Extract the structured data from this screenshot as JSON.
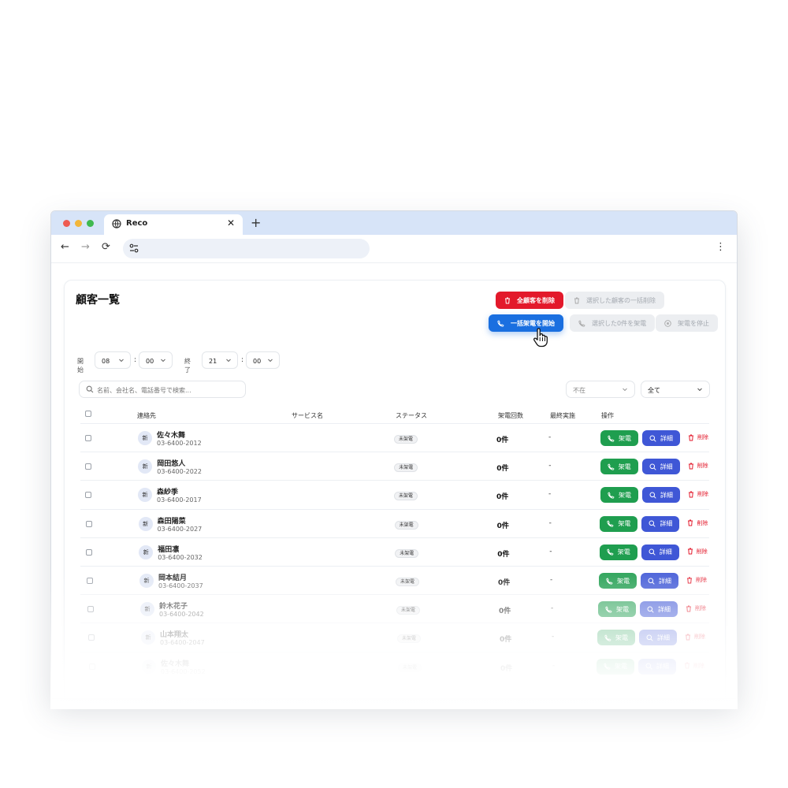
{
  "browser": {
    "tab_title": "Reco",
    "tab_close": "✕",
    "new_tab": "+",
    "nav_back": "←",
    "nav_forward": "→",
    "nav_reload": "⟳",
    "menu": "⋮"
  },
  "page": {
    "title": "顧客一覧"
  },
  "actions": {
    "delete_all": "全顧客を削除",
    "delete_selected": "選択した顧客の一括削除",
    "start_bulk_call": "一括架電を開始",
    "call_selected": "選択した0件を架電",
    "stop_call": "架電を停止"
  },
  "schedule": {
    "start_label": "開始",
    "start_hour": "08",
    "start_minute": "00",
    "end_label": "終了",
    "end_hour": "21",
    "end_minute": "00",
    "separator": ":"
  },
  "search": {
    "placeholder": "名前、会社名、電話番号で検索..."
  },
  "filters": {
    "status_filter": "不在",
    "all_filter": "全て"
  },
  "table": {
    "headers": {
      "contact": "連絡先",
      "service": "サービス名",
      "status": "ステータス",
      "call_count": "架電回数",
      "last_done": "最終実施",
      "actions": "操作"
    },
    "rows": [
      {
        "avatar": "新",
        "name": "佐々木舞",
        "phone": "03-6400-2012",
        "status": "未架電",
        "count": "0件",
        "last": "-",
        "call": "架電",
        "detail": "詳細",
        "delete": "削除"
      },
      {
        "avatar": "新",
        "name": "岡田悠人",
        "phone": "03-6400-2022",
        "status": "未架電",
        "count": "0件",
        "last": "-",
        "call": "架電",
        "detail": "詳細",
        "delete": "削除"
      },
      {
        "avatar": "新",
        "name": "森紗季",
        "phone": "03-6400-2017",
        "status": "未架電",
        "count": "0件",
        "last": "-",
        "call": "架電",
        "detail": "詳細",
        "delete": "削除"
      },
      {
        "avatar": "新",
        "name": "森田陽菜",
        "phone": "03-6400-2027",
        "status": "未架電",
        "count": "0件",
        "last": "-",
        "call": "架電",
        "detail": "詳細",
        "delete": "削除"
      },
      {
        "avatar": "新",
        "name": "福田凛",
        "phone": "03-6400-2032",
        "status": "未架電",
        "count": "0件",
        "last": "-",
        "call": "架電",
        "detail": "詳細",
        "delete": "削除"
      },
      {
        "avatar": "新",
        "name": "岡本結月",
        "phone": "03-6400-2037",
        "status": "未架電",
        "count": "0件",
        "last": "-",
        "call": "架電",
        "detail": "詳細",
        "delete": "削除"
      },
      {
        "avatar": "新",
        "name": "鈴木花子",
        "phone": "03-6400-2042",
        "status": "未架電",
        "count": "0件",
        "last": "-",
        "call": "架電",
        "detail": "詳細",
        "delete": "削除"
      },
      {
        "avatar": "新",
        "name": "山本翔太",
        "phone": "03-6400-2047",
        "status": "未架電",
        "count": "0件",
        "last": "-",
        "call": "架電",
        "detail": "詳細",
        "delete": "削除"
      },
      {
        "avatar": "新",
        "name": "佐々木舞",
        "phone": "03-6400-2052",
        "status": "未架電",
        "count": "0件",
        "last": "-",
        "call": "架電",
        "detail": "詳細",
        "delete": "削除"
      }
    ]
  },
  "colors": {
    "danger": "#e3192b",
    "primary": "#1a6fe0",
    "call_green": "#1f9e4f",
    "detail_blue": "#3f57d6",
    "tabbar": "#d7e4f8"
  },
  "icons": {
    "tab": "globe-icon",
    "address": "tune-icon",
    "search": "search-icon",
    "call": "phone-icon",
    "detail": "magnifier-icon",
    "delete": "trash-icon",
    "stop": "stop-circle-icon",
    "pointer": "hand-pointer-icon"
  }
}
